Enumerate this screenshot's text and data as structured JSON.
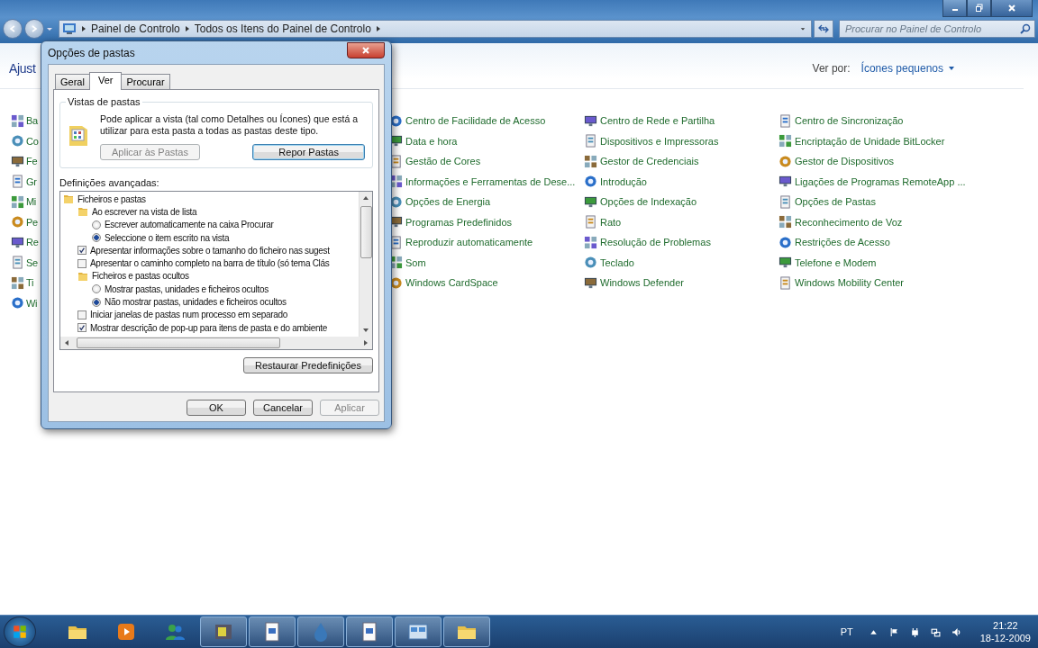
{
  "window": {
    "breadcrumb": [
      "Painel de Controlo",
      "Todos os Itens do Painel de Controlo"
    ],
    "search": {
      "placeholder": "Procurar no Painel de Controlo"
    }
  },
  "header": {
    "title": "Ajust",
    "view_by": {
      "label": "Ver por:",
      "value": "Ícones pequenos"
    }
  },
  "left_items": [
    "Ba",
    "Co",
    "Fe",
    "Gr",
    "Mi",
    "Pe",
    "Re",
    "Se",
    "Ti",
    "Wi"
  ],
  "items": [
    "Centro de Facilidade de Acesso",
    "Data e hora",
    "Gestão de Cores",
    "Informações e Ferramentas de Dese...",
    "Opções de Energia",
    "Programas Predefinidos",
    "Reproduzir automaticamente",
    "Som",
    "Windows CardSpace",
    "Centro de Rede e Partilha",
    "Dispositivos e Impressoras",
    "Gestor de Credenciais",
    "Introdução",
    "Opções de Indexação",
    "Rato",
    "Resolução de Problemas",
    "Teclado",
    "Windows Defender",
    "Centro de Sincronização",
    "Encriptação de Unidade BitLocker",
    "Gestor de Dispositivos",
    "Ligações de Programas RemoteApp ...",
    "Opções de Pastas",
    "Reconhecimento de Voz",
    "Restrições de Acesso",
    "Telefone e Modem",
    "Windows Mobility Center"
  ],
  "dialog": {
    "title": "Opções de pastas",
    "tabs": [
      {
        "label": "Geral",
        "selected": false
      },
      {
        "label": "Ver",
        "selected": true
      },
      {
        "label": "Procurar",
        "selected": false
      }
    ],
    "folder_views": {
      "title": "Vistas de pastas",
      "text": "Pode aplicar a vista (tal como Detalhes ou Ícones) que está a utilizar para esta pasta a todas as pastas deste tipo.",
      "buttons": [
        {
          "label": "Aplicar às Pastas",
          "disabled": true,
          "focused": false
        },
        {
          "label": "Repor Pastas",
          "disabled": false,
          "focused": true
        }
      ]
    },
    "advanced": {
      "label": "Definições avançadas:",
      "tree": [
        {
          "kind": "folder",
          "label": "Ficheiros e pastas",
          "children": [
            {
              "kind": "folder",
              "label": "Ao escrever na vista de lista",
              "children": [
                {
                  "kind": "radio",
                  "label": "Escrever automaticamente na caixa Procurar",
                  "selected": false
                },
                {
                  "kind": "radio",
                  "label": "Seleccione o item escrito na vista",
                  "selected": true
                }
              ]
            },
            {
              "kind": "checkbox",
              "label": "Apresentar informações sobre o tamanho do ficheiro nas sugest",
              "checked": true
            },
            {
              "kind": "checkbox",
              "label": "Apresentar o caminho completo na barra de título (só tema Clás",
              "checked": false
            },
            {
              "kind": "folder",
              "label": "Ficheiros e pastas ocultos",
              "children": [
                {
                  "kind": "radio",
                  "label": "Mostrar pastas, unidades e ficheiros ocultos",
                  "selected": false
                },
                {
                  "kind": "radio",
                  "label": "Não mostrar pastas, unidades e ficheiros ocultos",
                  "selected": true
                }
              ]
            },
            {
              "kind": "checkbox",
              "label": "Iniciar janelas de pastas num processo em separado",
              "checked": false
            },
            {
              "kind": "checkbox",
              "label": "Mostrar descrição de pop-up para itens de pasta e do ambiente",
              "checked": true
            }
          ]
        }
      ]
    },
    "restore_button": "Restaurar Predefinições",
    "buttons": [
      {
        "label": "OK",
        "disabled": false
      },
      {
        "label": "Cancelar",
        "disabled": false
      },
      {
        "label": "Aplicar",
        "disabled": true
      }
    ]
  },
  "taskbar": {
    "apps": [
      {
        "open": false
      },
      {
        "open": false
      },
      {
        "open": false
      },
      {
        "open": true
      },
      {
        "open": true
      },
      {
        "open": true
      },
      {
        "open": true
      },
      {
        "open": true
      },
      {
        "open": true
      }
    ],
    "language": "PT",
    "time": "21:22",
    "date": "18-12-2009"
  }
}
